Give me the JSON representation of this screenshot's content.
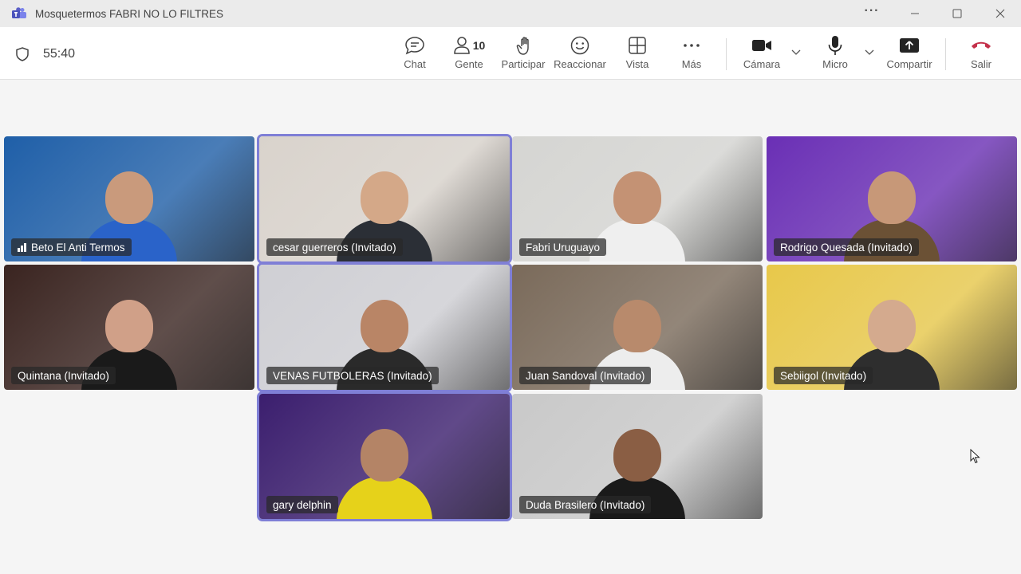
{
  "window": {
    "title": "Mosquetermos FABRI NO LO FILTRES",
    "more_label": "···"
  },
  "meeting": {
    "elapsed": "55:40"
  },
  "toolbar": {
    "chat": "Chat",
    "people": "Gente",
    "people_count": "10",
    "raise_hand": "Participar",
    "react": "Reaccionar",
    "view": "Vista",
    "more": "Más",
    "camera": "Cámara",
    "mic": "Micro",
    "share": "Compartir",
    "leave": "Salir"
  },
  "colors": {
    "active_speaker_border": "#7f7fd6",
    "leave_red": "#c4314b",
    "teams_purple": "#5b5fc7"
  },
  "participants": [
    {
      "name": "Beto El Anti Termos",
      "bg": "#1f5fa8",
      "shirt": "#2a63c9",
      "skin": "#c99a7c",
      "signal": true,
      "active": false
    },
    {
      "name": "cesar guerreros (Invitado)",
      "bg": "#d9d3cc",
      "shirt": "#2b2f36",
      "skin": "#d4a888",
      "signal": false,
      "active": true
    },
    {
      "name": "Fabri Uruguayo",
      "bg": "#d5d5d2",
      "shirt": "#efefef",
      "skin": "#c49274",
      "signal": false,
      "active": false
    },
    {
      "name": "Rodrigo Quesada (Invitado)",
      "bg": "#6a2fb5",
      "shirt": "#6b5135",
      "skin": "#c79878",
      "signal": false,
      "active": false
    },
    {
      "name": "Quintana (Invitado)",
      "bg": "#3a2420",
      "shirt": "#1a1a1a",
      "skin": "#d0a088",
      "signal": false,
      "active": false
    },
    {
      "name": "VENAS FUTBOLERAS (Invitado)",
      "bg": "#cfcfd4",
      "shirt": "#2a2a2a",
      "skin": "#b98566",
      "signal": false,
      "active": true
    },
    {
      "name": "Juan Sandoval (Invitado)",
      "bg": "#7a6a5a",
      "shirt": "#ededed",
      "skin": "#b88a6c",
      "signal": false,
      "active": false
    },
    {
      "name": "Sebiigol (Invitado)",
      "bg": "#e8c84a",
      "shirt": "#2e2e2e",
      "skin": "#d4aa8e",
      "signal": false,
      "active": false
    },
    {
      "name": "gary delphin",
      "bg": "#3b1e6e",
      "shirt": "#e6d21a",
      "skin": "#b48466",
      "signal": false,
      "active": true
    },
    {
      "name": "Duda Brasilero (Invitado)",
      "bg": "#c9c9c9",
      "shirt": "#1a1a1a",
      "skin": "#8a5e44",
      "signal": false,
      "active": false
    }
  ]
}
